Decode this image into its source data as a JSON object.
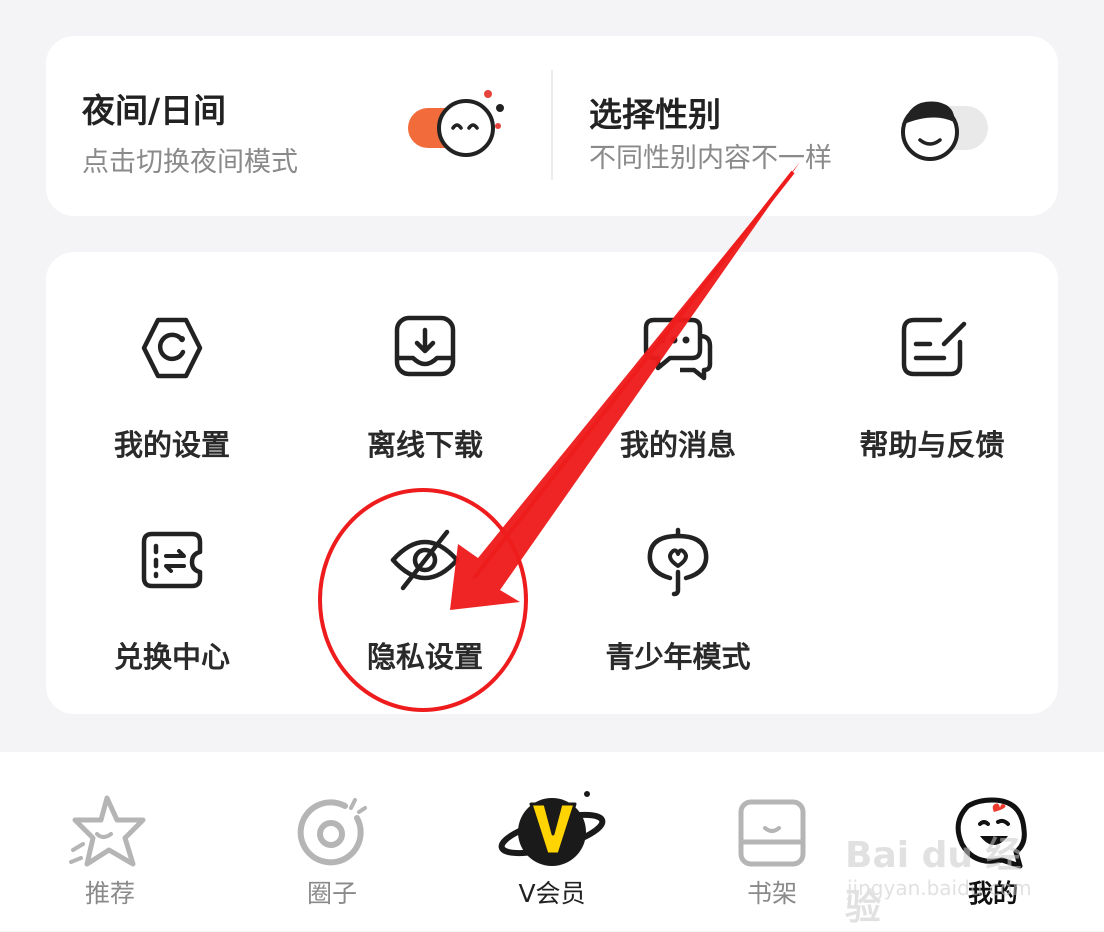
{
  "toggles": [
    {
      "title": "夜间/日间",
      "subtitle": "点击切换夜间模式"
    },
    {
      "title": "选择性别",
      "subtitle": "不同性别内容不一样"
    }
  ],
  "grid": [
    {
      "label": "我的设置",
      "icon": "settings-icon"
    },
    {
      "label": "离线下载",
      "icon": "download-icon"
    },
    {
      "label": "我的消息",
      "icon": "messages-icon"
    },
    {
      "label": "帮助与反馈",
      "icon": "feedback-icon"
    },
    {
      "label": "兑换中心",
      "icon": "exchange-ticket-icon"
    },
    {
      "label": "隐私设置",
      "icon": "privacy-eye-off-icon"
    },
    {
      "label": "青少年模式",
      "icon": "youth-mode-icon"
    }
  ],
  "nav": [
    {
      "label": "推荐",
      "icon": "star-icon"
    },
    {
      "label": "圈子",
      "icon": "circle-icon"
    },
    {
      "label": "V会员",
      "icon": "vip-planet-icon"
    },
    {
      "label": "书架",
      "icon": "bookshelf-icon"
    },
    {
      "label": "我的",
      "icon": "profile-face-icon"
    }
  ],
  "watermark": {
    "brand": "Bai du 经验",
    "url": "jingyan.baidu.com"
  },
  "colors": {
    "accent_orange": "#f26b3a",
    "annotation_red": "#ee1c1c",
    "vip_yellow": "#ffd400",
    "icon_dark": "#222222",
    "nav_gray": "#9a9a9a"
  }
}
